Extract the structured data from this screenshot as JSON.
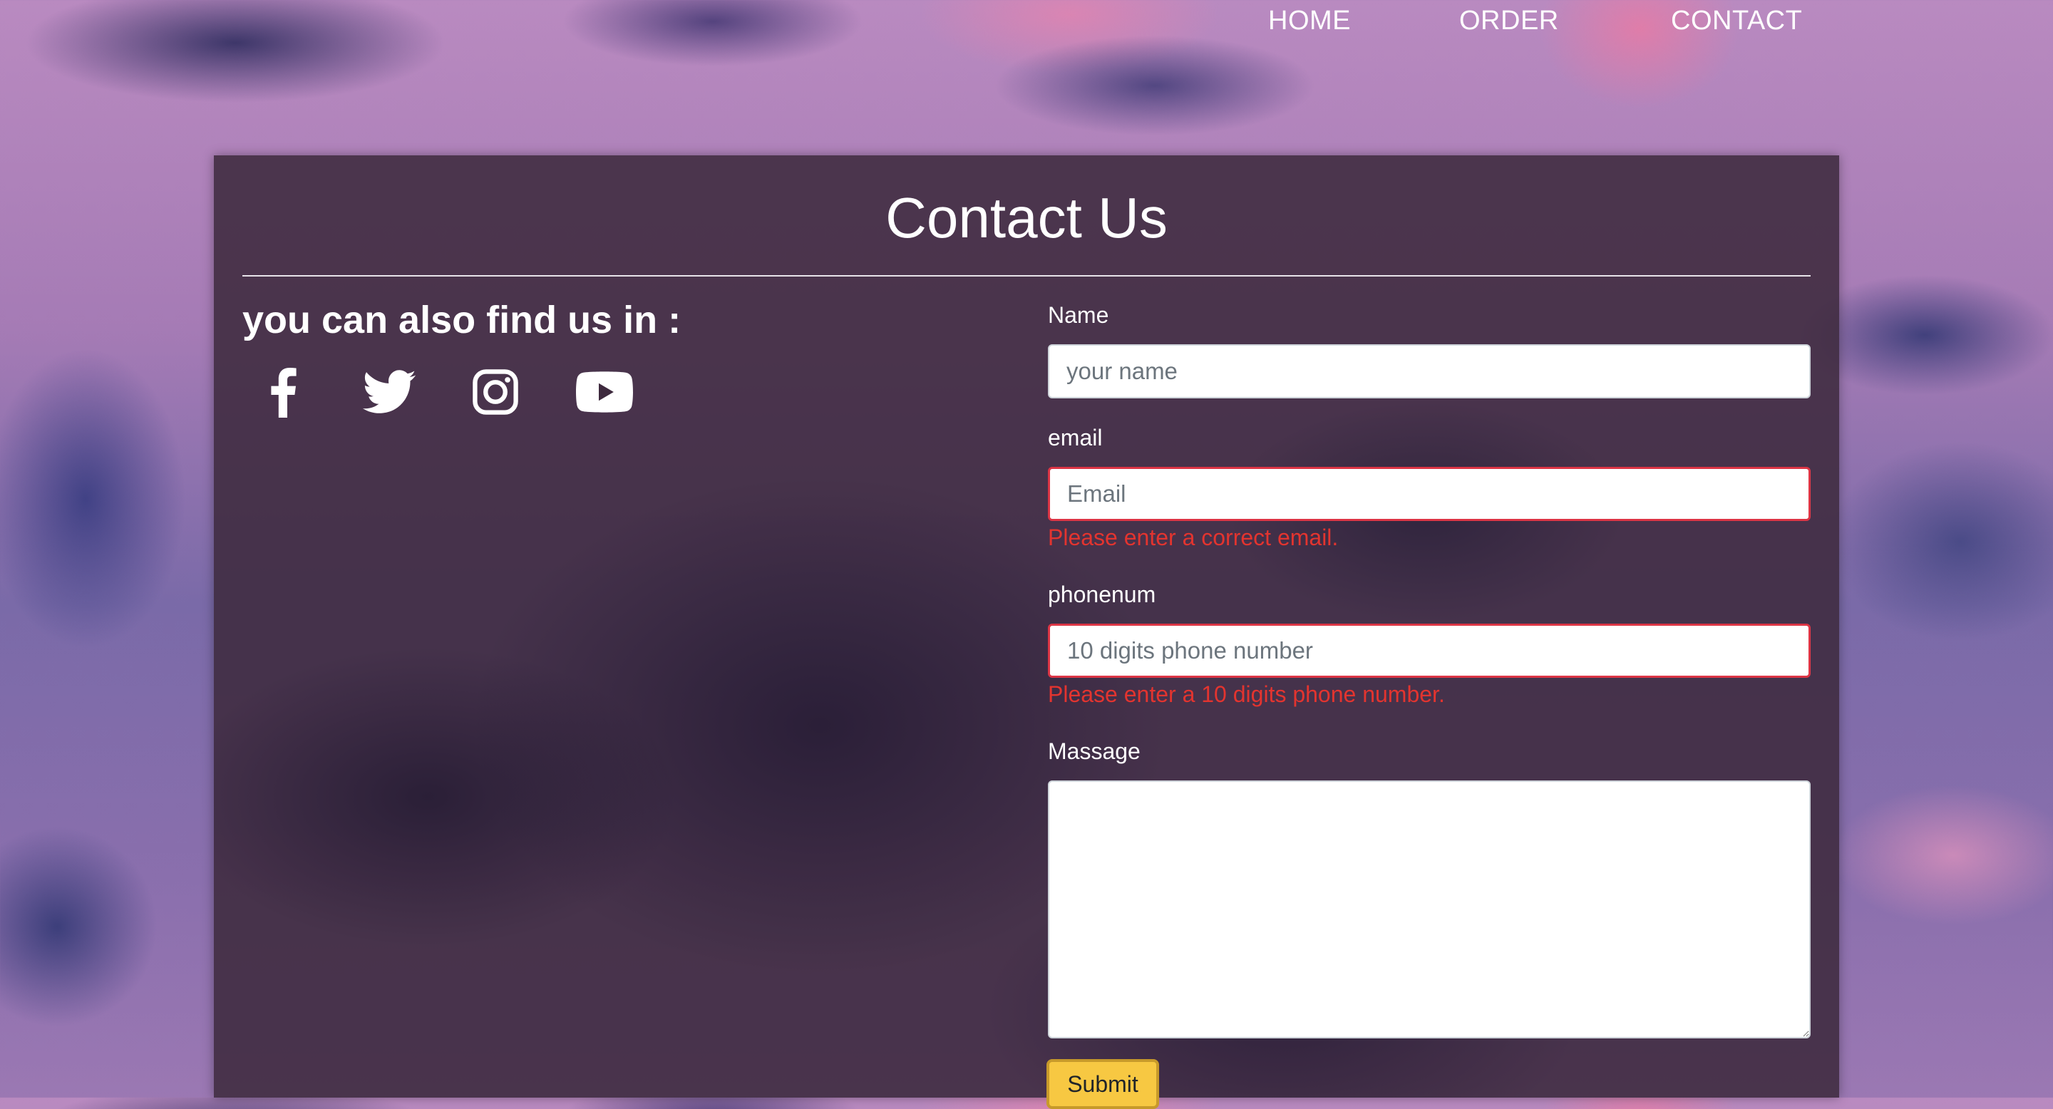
{
  "nav": {
    "items": [
      {
        "label": "HOME"
      },
      {
        "label": "ORDER"
      },
      {
        "label": "CONTACT"
      }
    ]
  },
  "contact": {
    "title": "Contact Us",
    "find_us": "you can also find us in :",
    "social_icons": [
      "facebook-icon",
      "twitter-icon",
      "instagram-icon",
      "youtube-icon"
    ]
  },
  "form": {
    "name": {
      "label": "Name",
      "placeholder": "your name",
      "value": ""
    },
    "email": {
      "label": "email",
      "placeholder": "Email",
      "value": "",
      "error": "Please enter a correct email."
    },
    "phone": {
      "label": "phonenum",
      "placeholder": "10 digits phone number",
      "value": "",
      "error": "Please enter a 10 digits phone number."
    },
    "message": {
      "label": "Massage",
      "value": ""
    },
    "submit_label": "Submit"
  },
  "colors": {
    "error": "#e3342f",
    "invalid_border": "#dc3545",
    "submit_bg": "#f7c842",
    "panel_bg": "#3e2a3e"
  }
}
